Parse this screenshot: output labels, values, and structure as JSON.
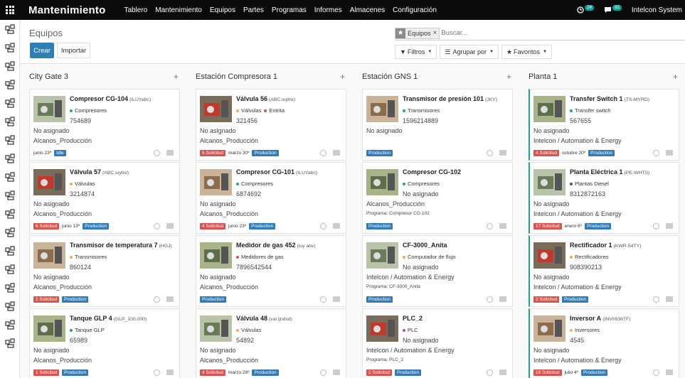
{
  "app": {
    "name": "Mantenimiento",
    "company": "Intelcon System"
  },
  "menu": [
    "Tablero",
    "Mantenimiento",
    "Equipos",
    "Partes",
    "Programas",
    "Informes",
    "Almacenes",
    "Configuración"
  ],
  "systray": {
    "activities_count": "24",
    "messages_count": "92"
  },
  "sidebar_icons": [
    "dashboard-icon",
    "factory-icon",
    "equipment-icon",
    "people-icon",
    "globe-icon",
    "hierarchy-icon",
    "tools-icon",
    "schedule-icon",
    "truck-icon",
    "gear-wrench-icon",
    "chart-search-icon",
    "location-icon",
    "transport-icon",
    "calendar-icon",
    "settings-icon",
    "sitemap-icon",
    "flow-icon",
    "stamp-icon"
  ],
  "breadcrumb": "Equipos",
  "buttons": {
    "create": "Crear",
    "import": "Importar"
  },
  "search": {
    "facet": "Equipos",
    "placeholder": "Buscar..."
  },
  "filters": {
    "filters": "Filtros",
    "group_by": "Agrupar por",
    "favorites": "Favoritos"
  },
  "columns": [
    {
      "title": "City Gate 3",
      "cards": [
        {
          "name": "Compresor CG-104",
          "ref": "(ILUYabc)",
          "tags": [
            {
              "label": "Compresores",
              "color": "#1aa97e"
            }
          ],
          "serial": "754689",
          "assigned": "No asignado",
          "location": "Alcanos_Producción",
          "requests": "",
          "date": "junio 23º",
          "status": "Idle"
        },
        {
          "name": "Válvula 57",
          "ref": "(ABC.iuytre)",
          "tags": [
            {
              "label": "Válvulas",
              "color": "#f0ad4e"
            }
          ],
          "serial": "3214874",
          "assigned": "No asignado",
          "location": "Alcanos_Producción",
          "requests": "6 Solicitud",
          "date": "junio 13º",
          "status": "Production"
        },
        {
          "name": "Transmisor de temperatura 7",
          "ref": "(HGJ)",
          "tags": [
            {
              "label": "Transmisores",
              "color": "#f0ad4e"
            }
          ],
          "serial": "860124",
          "assigned": "No asignado",
          "location": "Alcanos_Producción",
          "requests": "1 Solicitud",
          "date": "",
          "status": "Production"
        },
        {
          "name": "Tanque GLP 4",
          "ref": "(GLP_100.000)",
          "tags": [
            {
              "label": "Tanque GLP",
              "color": "#1aa97e"
            }
          ],
          "serial": "65989",
          "assigned": "No asignado",
          "location": "Alcanos_Producción",
          "requests": "1 Solicitud",
          "date": "",
          "status": "Production"
        }
      ]
    },
    {
      "title": "Estación Compresora 1",
      "cards": [
        {
          "name": "Válvula 56",
          "ref": "(ABC.iuytre)",
          "tags": [
            {
              "label": "Válvulas",
              "color": "#f0ad4e"
            },
            {
              "label": "Entrita",
              "color": "#d9534f"
            }
          ],
          "serial": "321456",
          "assigned": "No asignado",
          "location": "Alcanos_Producción",
          "requests": "5 Solicitud",
          "date": "marzo 30º",
          "status": "Production"
        },
        {
          "name": "Compresor CG-101",
          "ref": "(ILUYabc)",
          "tags": [
            {
              "label": "Compresores",
              "color": "#1aa97e"
            }
          ],
          "serial": "6874692",
          "assigned": "No asignado",
          "location": "Alcanos_Producción",
          "requests": "4 Solicitud",
          "date": "junio 23º",
          "status": "Production"
        },
        {
          "name": "Medidor de gas 452",
          "ref": "(iuy abv)",
          "tags": [
            {
              "label": "Medidores de gas",
              "color": "#d9534f"
            }
          ],
          "serial": "7896542544",
          "assigned": "No asignado",
          "location": "Alcanos_Producción",
          "requests": "",
          "date": "",
          "status": "Production"
        },
        {
          "name": "Válvula 48",
          "ref": "(val ijndsd)",
          "tags": [
            {
              "label": "Válvulas",
              "color": "#f0ad4e"
            }
          ],
          "serial": "54892",
          "assigned": "No asignado",
          "location": "Alcanos_Producción",
          "requests": "4 Solicitud",
          "date": "marzo 28º",
          "status": "Production"
        }
      ]
    },
    {
      "title": "Estación GNS 1",
      "cards": [
        {
          "name": "Transmisor de presión 101",
          "ref": "(JKY)",
          "tags": [
            {
              "label": "Transmisores",
              "color": "#1aa97e"
            }
          ],
          "serial": "1596214889",
          "assigned": "No asignado",
          "location": "",
          "program": "",
          "requests": "",
          "date": "",
          "status": "Production"
        },
        {
          "name": "Compresor CG-102",
          "ref": "",
          "tags": [
            {
              "label": "Compresores",
              "color": "#1aa97e"
            }
          ],
          "serial": "",
          "assigned": "No asignado",
          "location": "Alcanos_Producción",
          "program": "Programa: Compresor CG-102",
          "requests": "",
          "date": "",
          "status": "Production"
        },
        {
          "name": "CF-3000_Anita",
          "ref": "",
          "tags": [
            {
              "label": "Computador de flujo",
              "color": "#f0ad4e"
            }
          ],
          "serial": "",
          "assigned": "No asignado",
          "location": "Intelcon / Automation & Energy",
          "program": "Programa: CF-3000_Anita",
          "requests": "",
          "date": "",
          "status": "Production"
        },
        {
          "name": "PLC_2",
          "ref": "",
          "tags": [
            {
              "label": "PLC",
              "color": "#9b59b6"
            }
          ],
          "serial": "",
          "assigned": "No asignado",
          "location": "Intelcon / Automation & Energy",
          "program": "Programa: PLC_2",
          "requests": "2 Solicitud",
          "date": "",
          "status": "Production"
        }
      ]
    },
    {
      "title": "Planta 1",
      "cards": [
        {
          "name": "Transfer Switch 1",
          "ref": "(TS-MYRD)",
          "tags": [
            {
              "label": "Transfer switch",
              "color": "#1aa97e"
            }
          ],
          "serial": "567655",
          "assigned": "No asignado",
          "location": "Intelcon / Automation & Energy",
          "requests": "4 Solicitud",
          "date": "octubre 20º",
          "status": "Production"
        },
        {
          "name": "Planta Eléctrica 1",
          "ref": "(PE-WHTS)",
          "tags": [
            {
              "label": "Plantas Diesel",
              "color": "#555"
            }
          ],
          "serial": "8312872163",
          "assigned": "No asignado",
          "location": "Intelcon / Automation & Energy",
          "requests": "17 Solicitud",
          "date": "enero 6º",
          "status": "Production"
        },
        {
          "name": "Rectificador 1",
          "ref": "(KWR-54TY)",
          "tags": [
            {
              "label": "Rectificadores",
              "color": "#f0ad4e"
            }
          ],
          "serial": "908390213",
          "assigned": "No asignado",
          "location": "Intelcon / Automation & Energy",
          "requests": "2 Solicitud",
          "date": "",
          "status": "Production"
        },
        {
          "name": "Inversor A",
          "ref": "(INV0936TF)",
          "tags": [
            {
              "label": "Inversores",
              "color": "#f0ad4e"
            }
          ],
          "serial": "4545",
          "assigned": "No asignado",
          "location": "Intelcon / Automation & Energy",
          "requests": "18 Solicitud",
          "date": "julio 4º",
          "status": "Production"
        }
      ]
    }
  ]
}
